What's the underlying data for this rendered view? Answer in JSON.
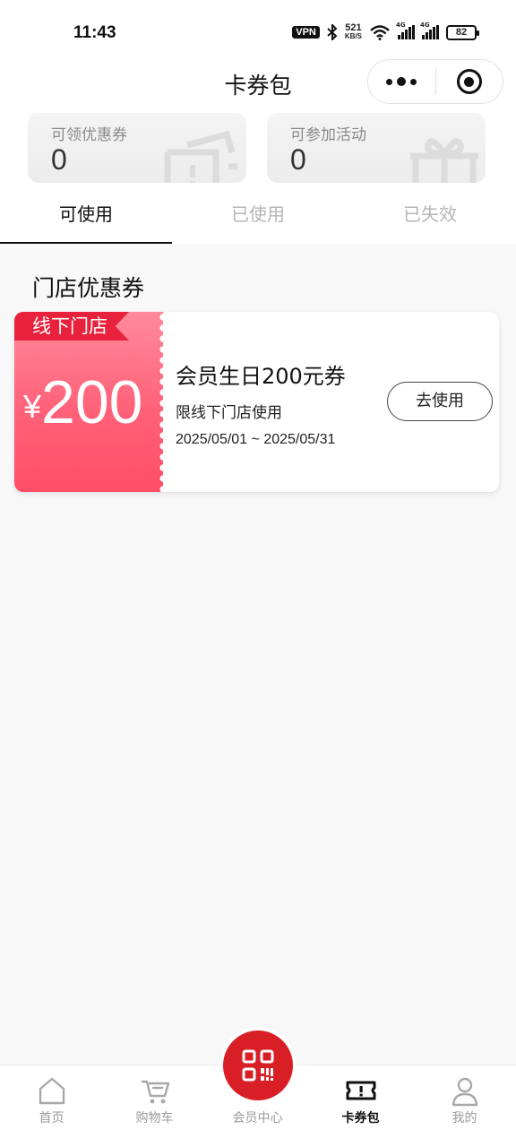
{
  "status_bar": {
    "time": "11:43",
    "vpn": "VPN",
    "net_speed": "521",
    "net_unit": "KB/S",
    "signal_1": "4G",
    "signal_2": "4G",
    "battery": "82"
  },
  "nav": {
    "title": "卡券包",
    "more_icon": "more-dots-icon",
    "close_icon": "target-close-icon"
  },
  "summary": [
    {
      "label": "可领优惠券",
      "value": "0",
      "icon": "ticket-icon"
    },
    {
      "label": "可参加活动",
      "value": "0",
      "icon": "gift-icon"
    }
  ],
  "tabs": [
    {
      "label": "可使用",
      "active": true
    },
    {
      "label": "已使用",
      "active": false
    },
    {
      "label": "已失效",
      "active": false
    }
  ],
  "section_title": "门店优惠券",
  "coupon": {
    "tag": "线下门店",
    "currency": "¥",
    "amount": "200",
    "name": "会员生日200元券",
    "limit": "限线下门店使用",
    "date_range": "2025/05/01 ~ 2025/05/31",
    "button": "去使用",
    "color_top": "#ff8a99",
    "color_bottom": "#ff4e66",
    "tag_color": "#e8213d"
  },
  "tabbar": [
    {
      "label": "首页",
      "icon": "home-icon",
      "active": false
    },
    {
      "label": "购物车",
      "icon": "cart-icon",
      "active": false
    },
    {
      "label": "会员中心",
      "icon": "qr-code-icon",
      "active": false
    },
    {
      "label": "卡券包",
      "icon": "coupon-ticket-icon",
      "active": true
    },
    {
      "label": "我的",
      "icon": "user-icon",
      "active": false
    }
  ],
  "colors": {
    "accent": "#d91f26",
    "active_text": "#111111",
    "inactive_text": "#b5b5b5"
  }
}
